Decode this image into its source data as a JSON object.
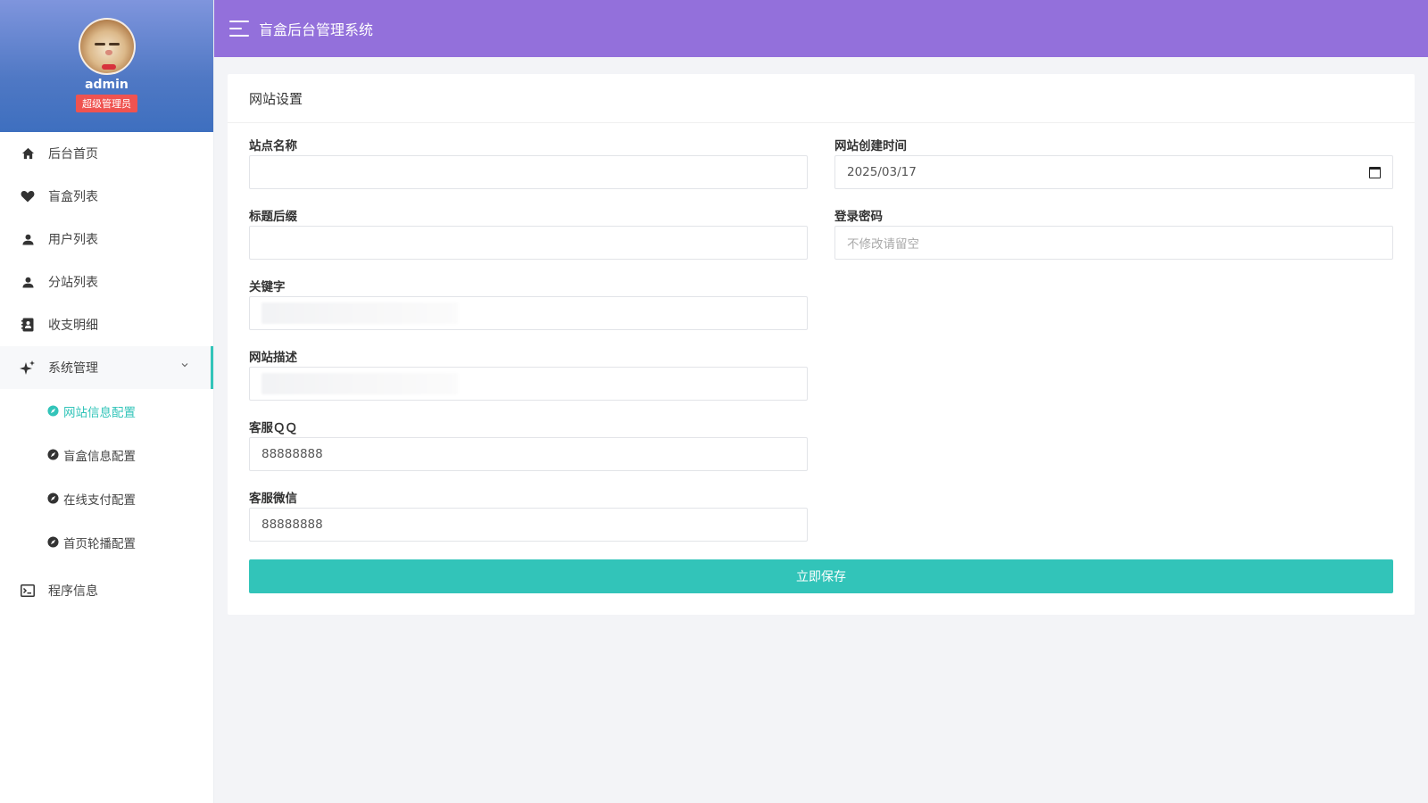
{
  "app": {
    "title": "盲盒后台管理系统"
  },
  "profile": {
    "name": "admin",
    "role": "超级管理员"
  },
  "sidebar": {
    "items": [
      {
        "label": "后台首页",
        "icon": "home-icon"
      },
      {
        "label": "盲盒列表",
        "icon": "heart-icon"
      },
      {
        "label": "用户列表",
        "icon": "user-icon"
      },
      {
        "label": "分站列表",
        "icon": "user-icon"
      },
      {
        "label": "收支明细",
        "icon": "contact-book-icon"
      },
      {
        "label": "系统管理",
        "icon": "sparkle-icon",
        "expanded": true
      },
      {
        "label": "程序信息",
        "icon": "terminal-icon"
      }
    ],
    "submenu": [
      {
        "label": "网站信息配置",
        "current": true
      },
      {
        "label": "盲盒信息配置"
      },
      {
        "label": "在线支付配置"
      },
      {
        "label": "首页轮播配置"
      }
    ]
  },
  "form": {
    "title": "网站设置",
    "site_name": {
      "label": "站点名称",
      "value": ""
    },
    "title_suffix": {
      "label": "标题后缀",
      "value": ""
    },
    "keywords": {
      "label": "关键字",
      "value": ""
    },
    "description": {
      "label": "网站描述",
      "value": ""
    },
    "service_qq": {
      "label": "客服ＱＱ",
      "value": "88888888"
    },
    "service_wechat": {
      "label": "客服微信",
      "value": "88888888"
    },
    "created_date": {
      "label": "网站创建时间",
      "value": "2025/03/17"
    },
    "login_password": {
      "label": "登录密码",
      "placeholder": "不修改请留空"
    },
    "save_label": "立即保存"
  },
  "colors": {
    "header_bg": "#9370db",
    "accent": "#32c4b9",
    "role_badge": "#ef5350"
  }
}
